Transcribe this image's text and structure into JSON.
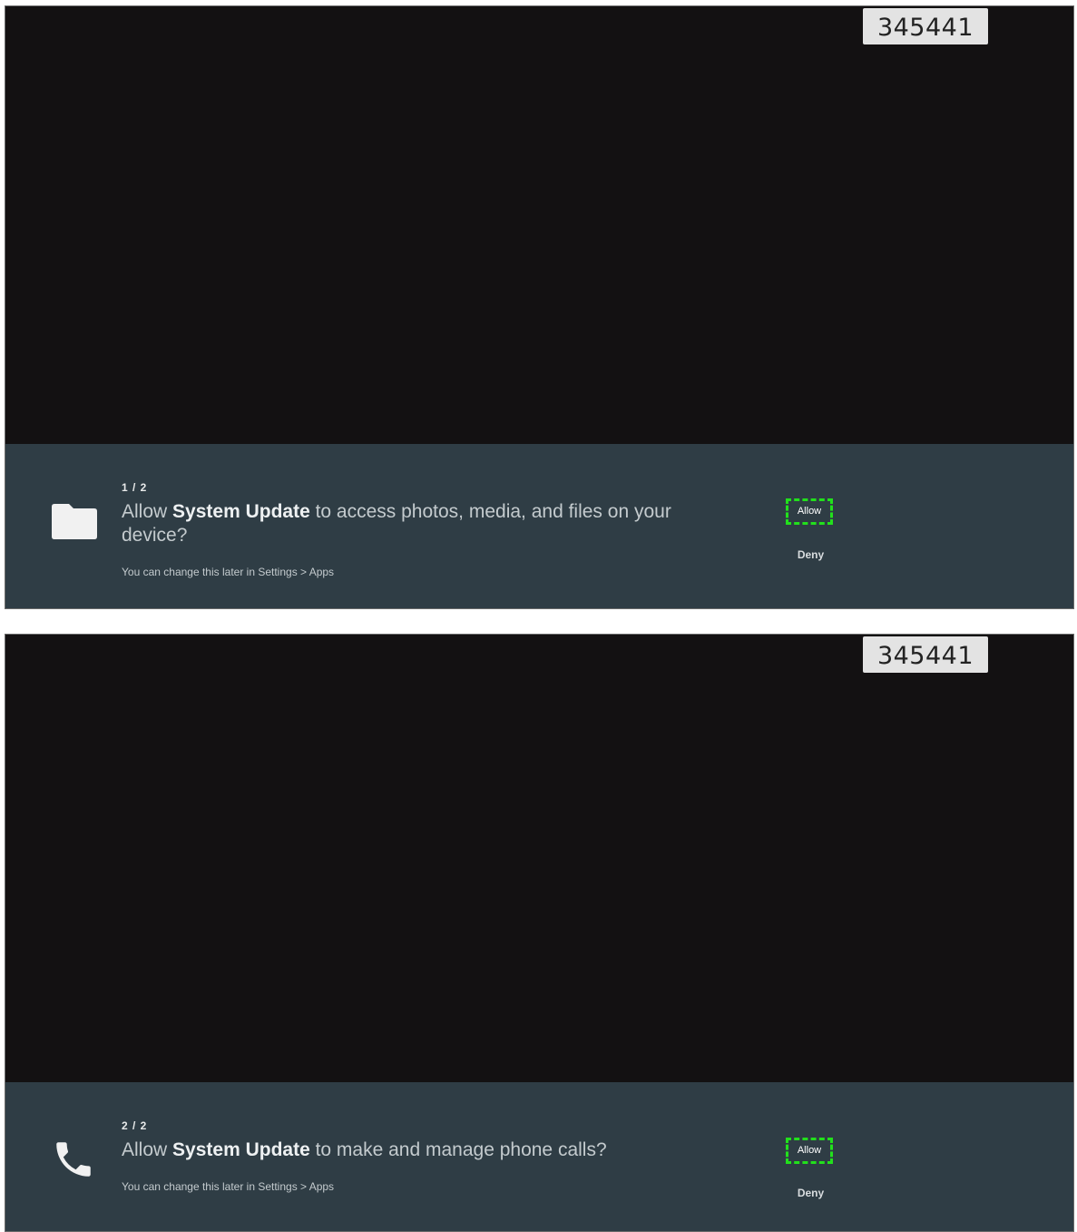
{
  "code_badge": "345441",
  "dialogs": [
    {
      "counter": "1 / 2",
      "question_prefix": "Allow ",
      "app_name": "System Update",
      "question_suffix": " to access photos, media, and files on your device?",
      "hint": "You can change this later in Settings > Apps",
      "allow_label": "Allow",
      "deny_label": "Deny",
      "icon": "folder-icon"
    },
    {
      "counter": "2 / 2",
      "question_prefix": "Allow ",
      "app_name": "System Update",
      "question_suffix": " to make and manage phone calls?",
      "hint": "You can change this later in Settings > Apps",
      "allow_label": "Allow",
      "deny_label": "Deny",
      "icon": "phone-icon"
    }
  ],
  "colors": {
    "screen_background": "#131112",
    "panel_background": "#2f3d45",
    "focus_outline": "#22e01c"
  }
}
